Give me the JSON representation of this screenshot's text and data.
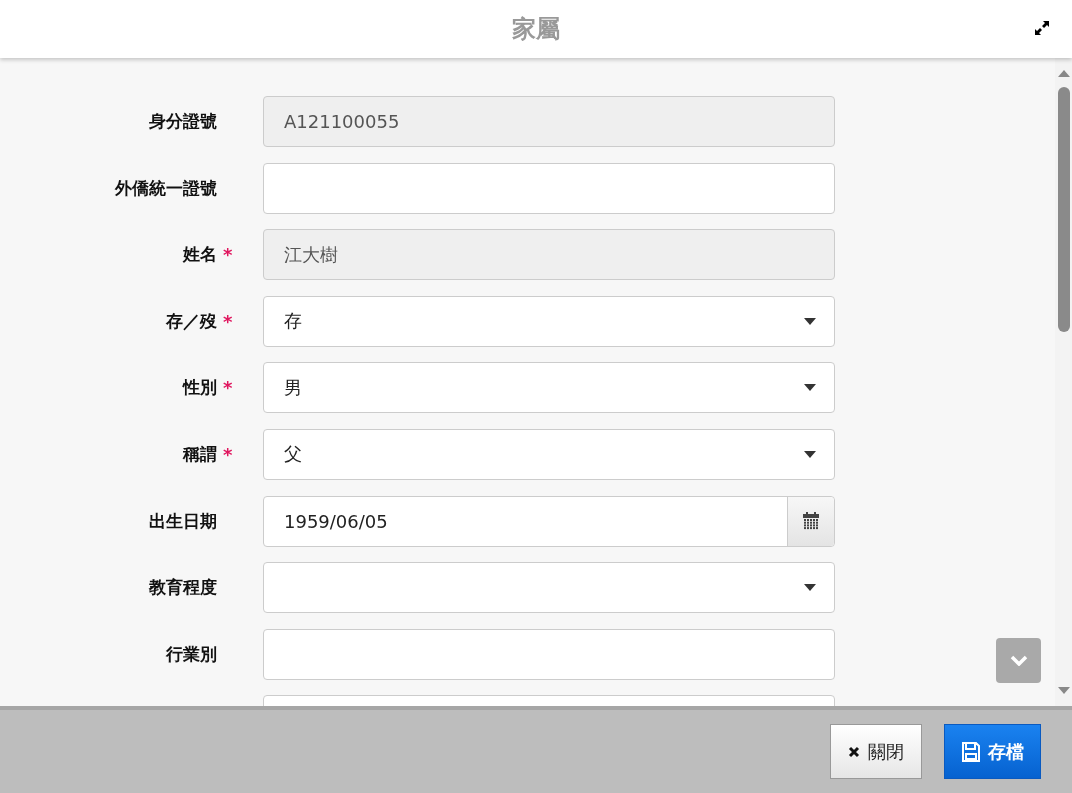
{
  "dialog": {
    "title": "家屬"
  },
  "required_mark": "*",
  "fields": [
    {
      "kind": "text",
      "label": "身分證號",
      "value": "A121100055",
      "required": false,
      "disabled": true
    },
    {
      "kind": "text",
      "label": "外僑統一證號",
      "required": false,
      "disabled": false
    },
    {
      "kind": "text",
      "label": "姓名",
      "value": "江大樹",
      "required": true,
      "disabled": true
    },
    {
      "kind": "select",
      "label": "存／歿",
      "value": "存",
      "required": true,
      "disabled": false
    },
    {
      "kind": "select",
      "label": "性別",
      "value": "男",
      "required": true,
      "disabled": false
    },
    {
      "kind": "select",
      "label": "稱謂",
      "value": "父",
      "required": true,
      "disabled": false
    },
    {
      "kind": "date",
      "label": "出生日期",
      "value": "1959/06/05",
      "required": false,
      "disabled": false
    },
    {
      "kind": "select",
      "label": "教育程度",
      "required": false,
      "disabled": false
    },
    {
      "kind": "text",
      "label": "行業別",
      "required": false,
      "disabled": false
    },
    {
      "kind": "text",
      "disabled": false
    }
  ],
  "buttons": [
    {
      "kind": "close",
      "label": "關閉"
    },
    {
      "kind": "save",
      "label": "存檔"
    }
  ]
}
